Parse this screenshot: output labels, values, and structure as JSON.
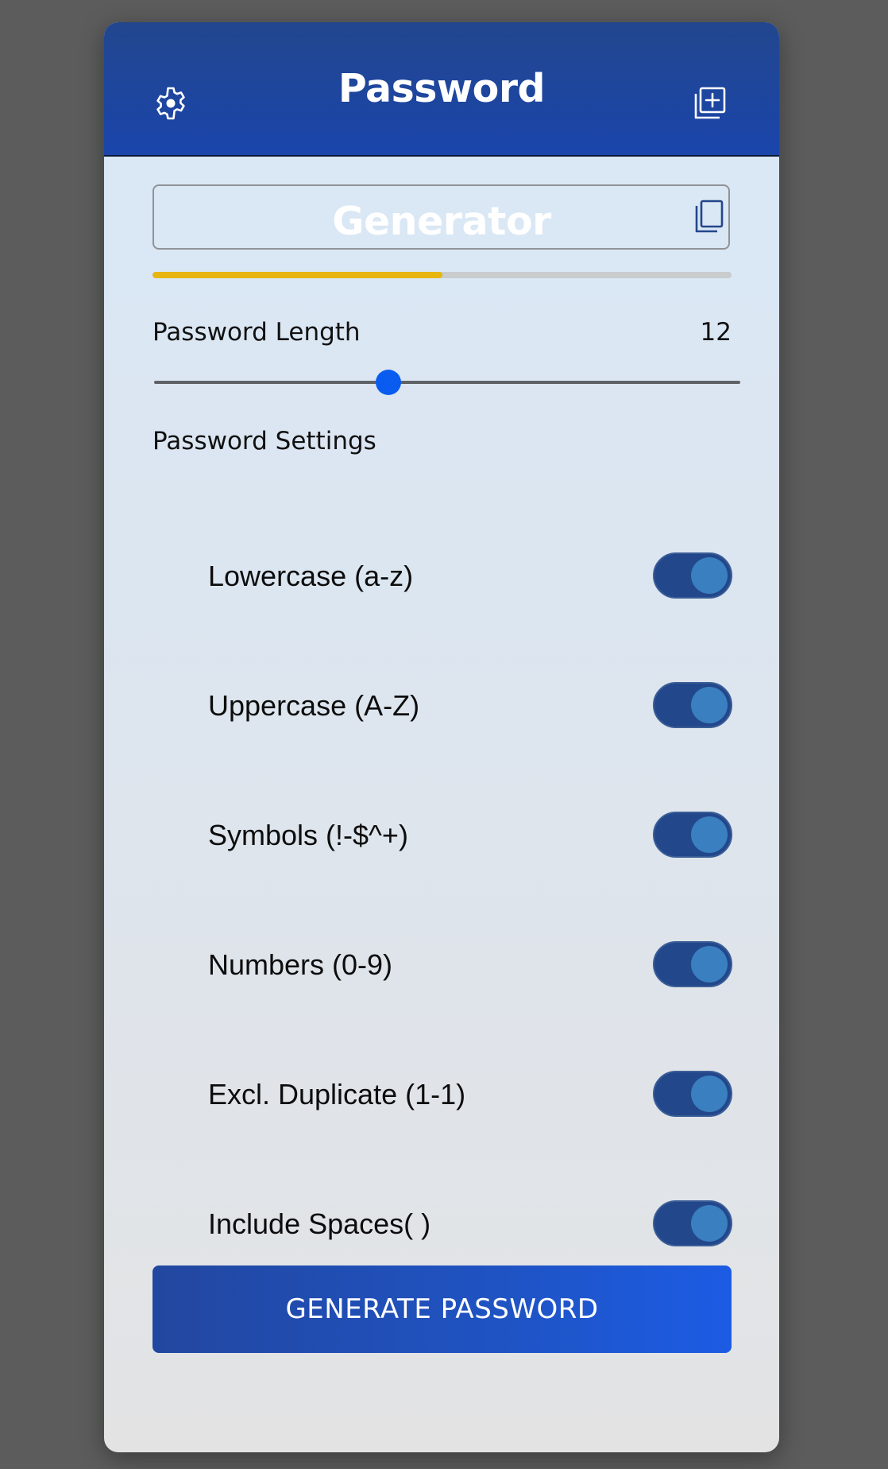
{
  "header": {
    "title": "Password Generator",
    "settings_icon": "gear-icon",
    "add_icon": "add-copy-icon"
  },
  "password_field": {
    "value": "",
    "placeholder": "",
    "copy_icon": "copy-icon"
  },
  "strength": {
    "fraction": 0.5,
    "color": "#e8b611"
  },
  "length": {
    "label": "Password Length",
    "value": "12",
    "min": 0,
    "max": 30
  },
  "settings": {
    "title": "Password Settings",
    "options": [
      {
        "label": "Lowercase (a-z)",
        "enabled": true
      },
      {
        "label": "Uppercase (A-Z)",
        "enabled": true
      },
      {
        "label": "Symbols (!-$^+)",
        "enabled": true
      },
      {
        "label": "Numbers (0-9)",
        "enabled": true
      },
      {
        "label": "Excl. Duplicate (1-1)",
        "enabled": true
      },
      {
        "label": "Include Spaces( )",
        "enabled": true
      }
    ]
  },
  "generate_button": {
    "label": "GENERATE PASSWORD"
  },
  "colors": {
    "header": "#1a45ab",
    "accent": "#0a5cf0",
    "toggle_on": "#23478b",
    "button": "#1f53c3"
  }
}
